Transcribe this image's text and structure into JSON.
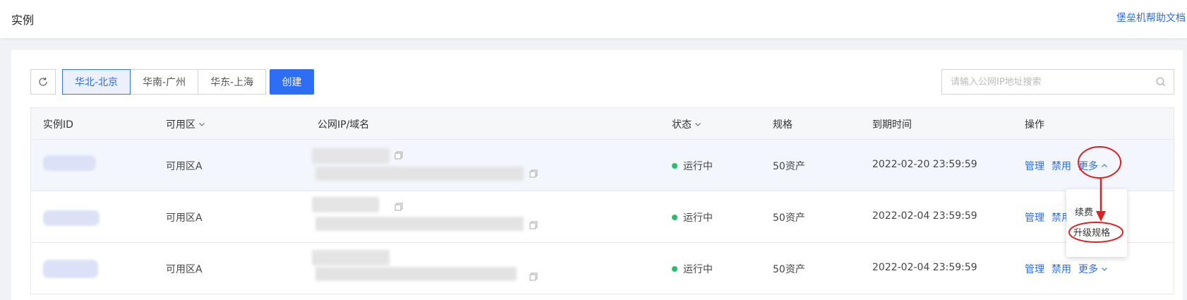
{
  "header": {
    "title": "实例",
    "help_link": "堡垒机帮助文档"
  },
  "toolbar": {
    "refresh_icon": "refresh-icon",
    "regions": [
      {
        "label": "华北-北京",
        "active": true
      },
      {
        "label": "华南-广州"
      },
      {
        "label": "华东-上海"
      }
    ],
    "create_label": "创建",
    "search_placeholder": "请输入公网IP地址搜索",
    "search_icon": "search-icon"
  },
  "table": {
    "columns": {
      "id": "实例ID",
      "zone": "可用区",
      "ip": "公网IP/域名",
      "status": "状态",
      "spec": "规格",
      "expire": "到期时间",
      "ops": "操作"
    },
    "rows": [
      {
        "zone": "可用区A",
        "status": "运行中",
        "spec": "50资产",
        "expire": "2022-02-20 23:59:59",
        "manage": "管理",
        "disable": "禁用",
        "more": "更多"
      },
      {
        "zone": "可用区A",
        "status": "运行中",
        "spec": "50资产",
        "expire": "2022-02-04 23:59:59",
        "manage": "管理",
        "disable": "禁用"
      },
      {
        "zone": "可用区A",
        "status": "运行中",
        "spec": "50资产",
        "expire": "2022-02-04 23:59:59",
        "manage": "管理",
        "disable": "禁用",
        "more": "更多"
      }
    ]
  },
  "more_menu": {
    "items": [
      {
        "label": "续费"
      },
      {
        "label": "升级规格"
      }
    ]
  },
  "colors": {
    "primary": "#2d6ef5",
    "link": "#2b6de5",
    "running": "#27c06a",
    "annotation": "#e02020"
  }
}
